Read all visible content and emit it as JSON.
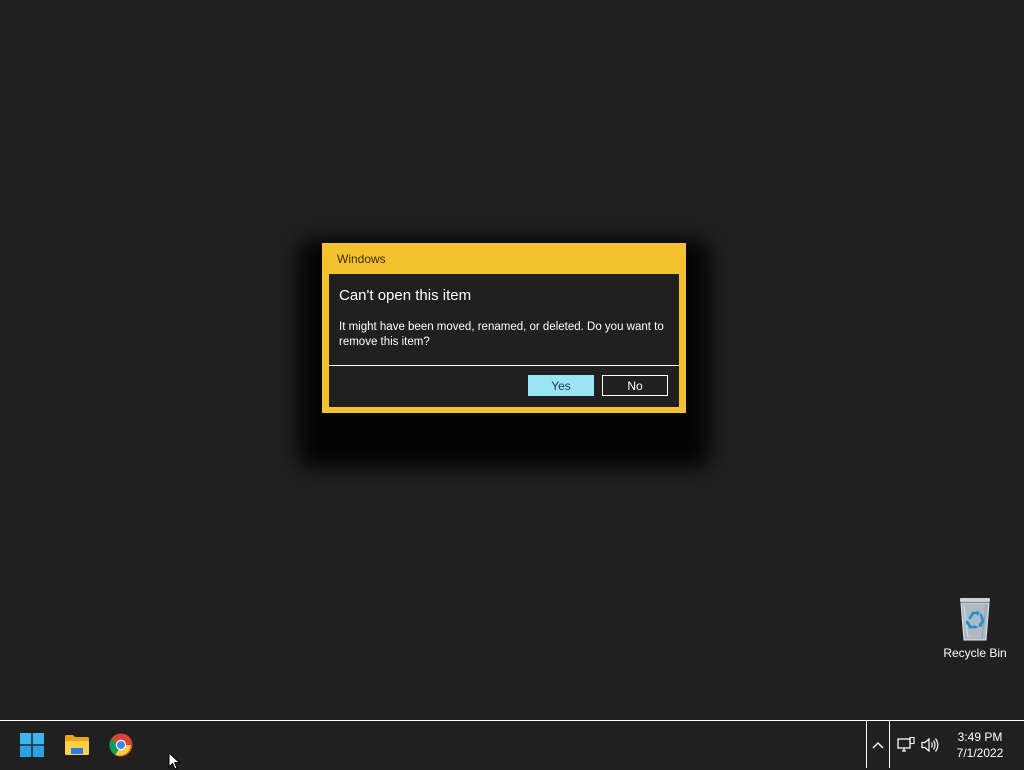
{
  "dialog": {
    "title": "Windows",
    "heading": "Can't open this item",
    "message": "It might have been moved, renamed, or deleted. Do you want to remove this item?",
    "yes_label": "Yes",
    "no_label": "No"
  },
  "desktop": {
    "icons": [
      {
        "label": "Recycle Bin",
        "icon": "recycle-bin-icon"
      }
    ]
  },
  "taskbar": {
    "pinned": [
      {
        "name": "start",
        "icon": "windows-logo-icon"
      },
      {
        "name": "file-explorer",
        "icon": "folder-icon"
      },
      {
        "name": "chrome",
        "icon": "chrome-icon"
      }
    ],
    "tray": {
      "icons": [
        "chevron-up-icon",
        "network-icon",
        "volume-icon"
      ]
    },
    "clock": {
      "time": "3:49 PM",
      "date": "7/1/2022"
    }
  },
  "colors": {
    "dialog_accent": "#f4c12f",
    "primary_button": "#99e5f5",
    "background": "#202020"
  }
}
